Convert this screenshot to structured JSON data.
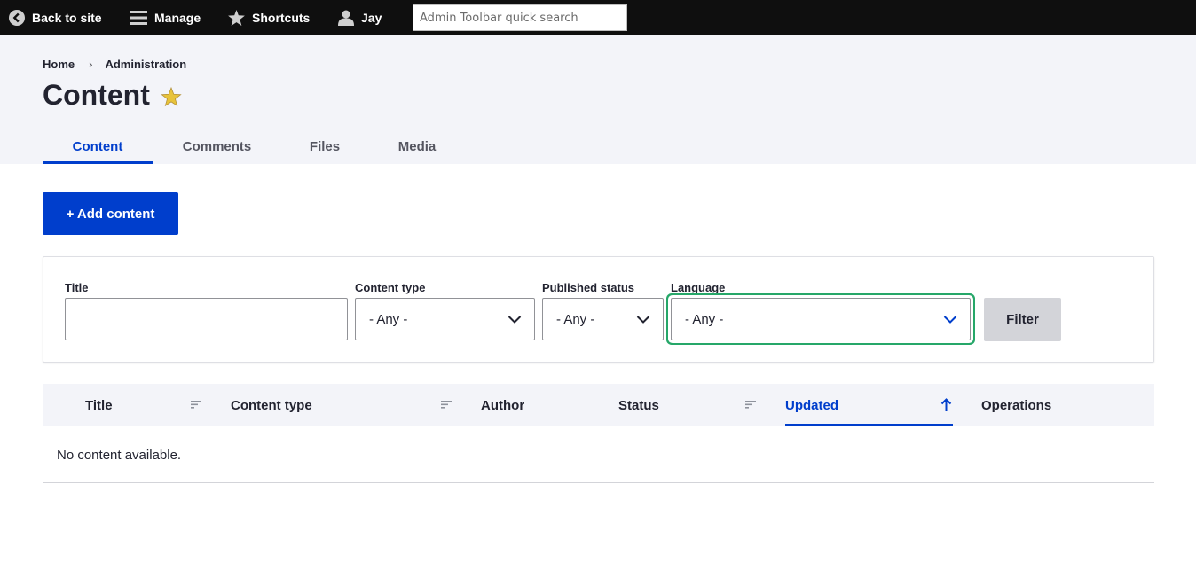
{
  "toolbar": {
    "back_to_site": "Back to site",
    "manage": "Manage",
    "shortcuts": "Shortcuts",
    "user": "Jay",
    "search_placeholder": "Admin Toolbar quick search"
  },
  "breadcrumb": [
    "Home",
    "Administration"
  ],
  "breadcrumb_separator": "›",
  "page_title": "Content",
  "tabs": [
    {
      "label": "Content",
      "active": true
    },
    {
      "label": "Comments",
      "active": false
    },
    {
      "label": "Files",
      "active": false
    },
    {
      "label": "Media",
      "active": false
    }
  ],
  "add_content_label": "+ Add content",
  "filters": {
    "title": {
      "label": "Title",
      "value": ""
    },
    "content_type": {
      "label": "Content type",
      "value": "- Any -"
    },
    "published_status": {
      "label": "Published status",
      "value": "- Any -"
    },
    "language": {
      "label": "Language",
      "value": "- Any -"
    },
    "filter_button": "Filter"
  },
  "table": {
    "columns": [
      "Title",
      "Content type",
      "Author",
      "Status",
      "Updated",
      "Operations"
    ],
    "active_sort_column": "Updated",
    "empty_message": "No content available."
  },
  "colors": {
    "accent": "#003ecc",
    "focus_ring": "#26a769",
    "toolbar_bg": "#0f0f0f",
    "header_bg": "#f3f4f9",
    "star": "#e8c33a"
  }
}
